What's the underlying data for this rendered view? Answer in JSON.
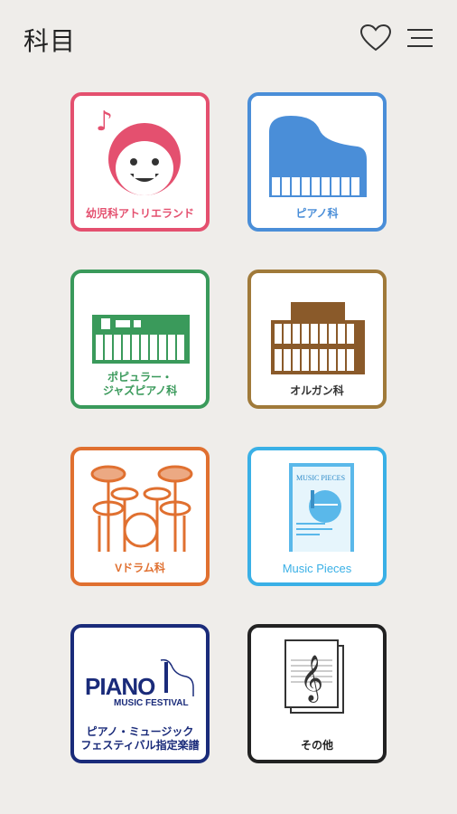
{
  "header": {
    "title": "科目",
    "favorite_icon": "heart-icon",
    "menu_icon": "menu-icon"
  },
  "tiles": [
    {
      "label": "幼児科アトリエランド",
      "color": "#e4506f",
      "icon": "child-face-music-icon"
    },
    {
      "label": "ピアノ科",
      "color": "#4a8ed8",
      "icon": "grand-piano-icon"
    },
    {
      "label": "ポピュラー・\nジャズピアノ科",
      "color": "#3a9a5b",
      "icon": "keyboard-icon"
    },
    {
      "label": "オルガン科",
      "color": "#a07a3a",
      "icon": "organ-icon"
    },
    {
      "label": "Vドラム科",
      "color": "#e07030",
      "icon": "drum-kit-icon"
    },
    {
      "label": "Music Pieces",
      "color": "#3ab0e6",
      "icon": "music-pieces-book-icon"
    },
    {
      "label": "ピアノ・ミュージック\nフェスティバル指定楽譜",
      "color": "#1a2b7a",
      "icon": "piano-music-festival-logo",
      "logo_text": [
        "PIANO",
        "MUSIC FESTIVAL"
      ]
    },
    {
      "label": "その他",
      "color": "#222222",
      "icon": "sheet-music-icon"
    }
  ],
  "music_pieces_cover": [
    "MUSIC PIECES"
  ]
}
